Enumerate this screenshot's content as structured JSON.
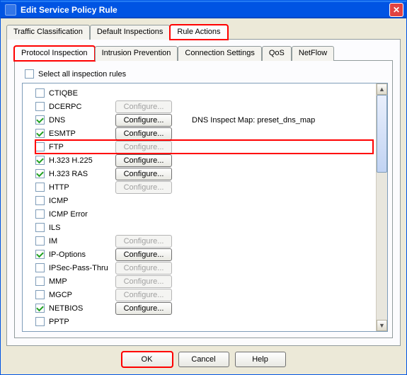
{
  "window": {
    "title": "Edit Service Policy Rule"
  },
  "outerTabs": {
    "traffic": "Traffic Classification",
    "default": "Default Inspections",
    "rule": "Rule Actions"
  },
  "innerTabs": {
    "protocol": "Protocol Inspection",
    "intrusion": "Intrusion Prevention",
    "connection": "Connection Settings",
    "qos": "QoS",
    "netflow": "NetFlow"
  },
  "selectAllLabel": "Select all inspection rules",
  "configureLabel": "Configure...",
  "dnsNote": "DNS Inspect Map: preset_dns_map",
  "buttons": {
    "ok": "OK",
    "cancel": "Cancel",
    "help": "Help"
  },
  "items": [
    {
      "name": "CTIQBE",
      "checked": false,
      "configure": false
    },
    {
      "name": "DCERPC",
      "checked": false,
      "configure": "disabled"
    },
    {
      "name": "DNS",
      "checked": true,
      "configure": true,
      "note": true
    },
    {
      "name": "ESMTP",
      "checked": true,
      "configure": true
    },
    {
      "name": "FTP",
      "checked": false,
      "configure": "disabled",
      "hl": true
    },
    {
      "name": "H.323 H.225",
      "checked": true,
      "configure": true
    },
    {
      "name": "H.323 RAS",
      "checked": true,
      "configure": true
    },
    {
      "name": "HTTP",
      "checked": false,
      "configure": "disabled"
    },
    {
      "name": "ICMP",
      "checked": false,
      "configure": false
    },
    {
      "name": "ICMP Error",
      "checked": false,
      "configure": false
    },
    {
      "name": "ILS",
      "checked": false,
      "configure": false
    },
    {
      "name": "IM",
      "checked": false,
      "configure": "disabled"
    },
    {
      "name": "IP-Options",
      "checked": true,
      "configure": true
    },
    {
      "name": "IPSec-Pass-Thru",
      "checked": false,
      "configure": "disabled"
    },
    {
      "name": "MMP",
      "checked": false,
      "configure": "disabled"
    },
    {
      "name": "MGCP",
      "checked": false,
      "configure": "disabled"
    },
    {
      "name": "NETBIOS",
      "checked": true,
      "configure": true
    },
    {
      "name": "PPTP",
      "checked": false,
      "configure": false
    }
  ]
}
